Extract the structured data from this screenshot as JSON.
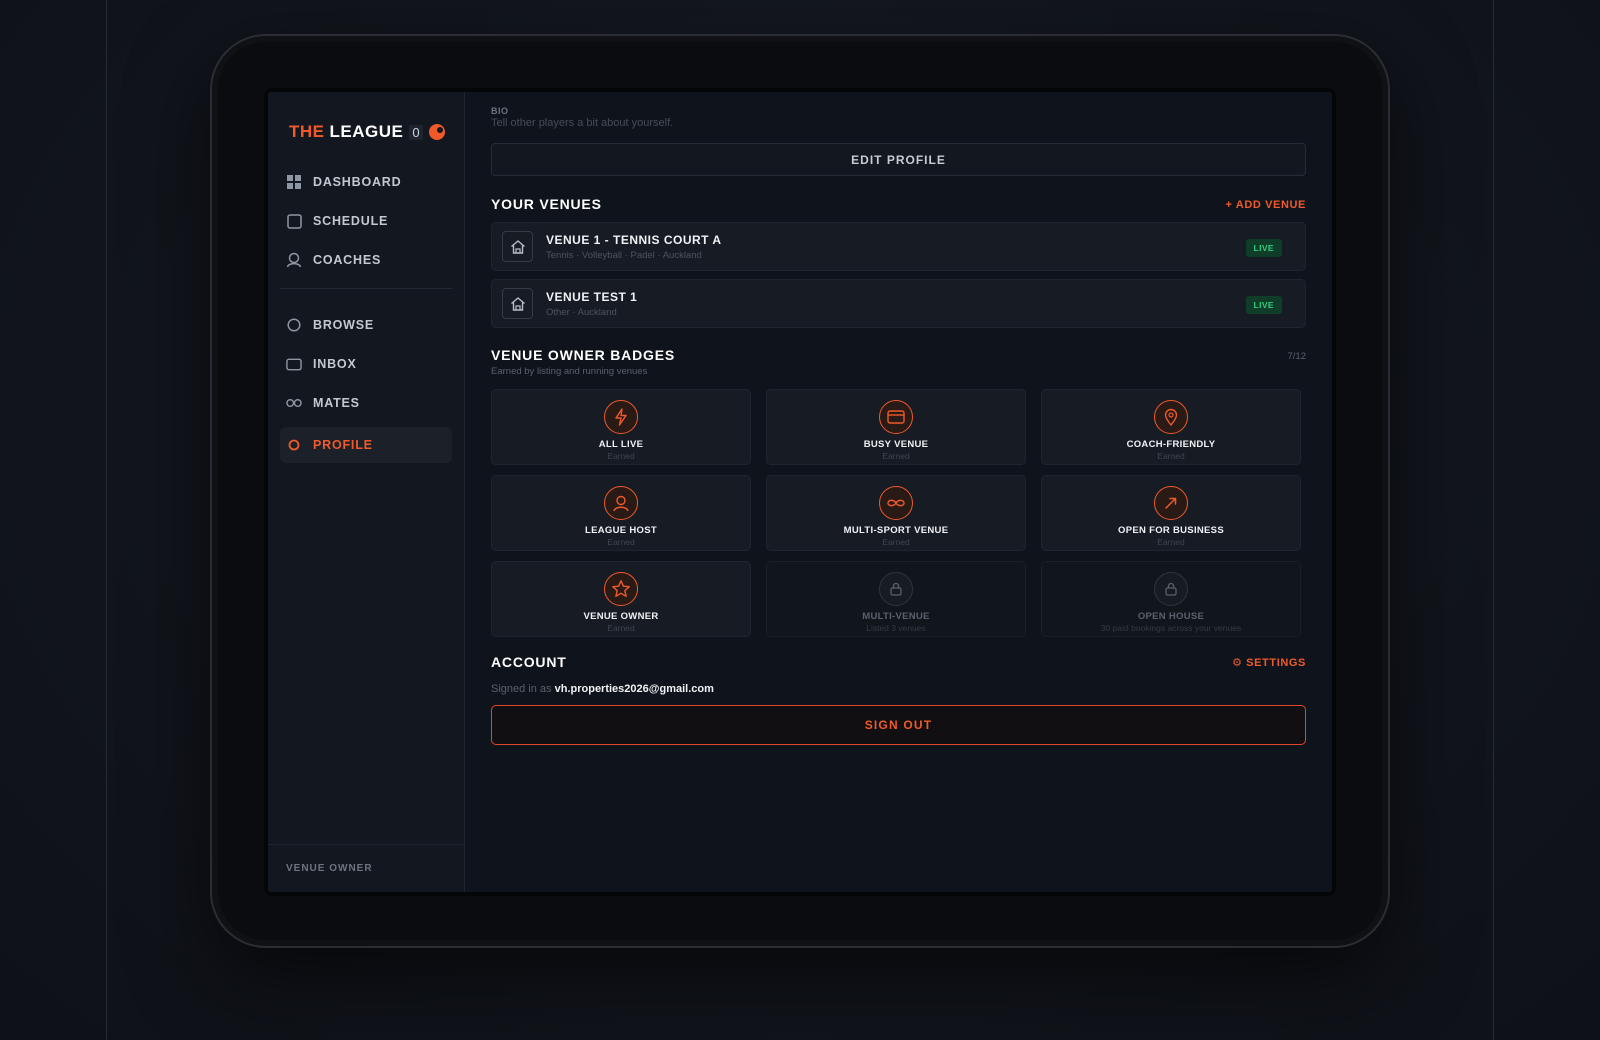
{
  "app": {
    "brand_the": "THE",
    "brand_league": "LEAGUE",
    "brand_count": "0",
    "accent_color": "#f05a2a"
  },
  "sidebar": {
    "items": [
      {
        "label": "DASHBOARD",
        "icon": "grid-icon"
      },
      {
        "label": "SCHEDULE",
        "icon": "calendar-icon"
      },
      {
        "label": "COACHES",
        "icon": "coach-icon"
      },
      {
        "label": "BROWSE",
        "icon": "circle-icon"
      },
      {
        "label": "INBOX",
        "icon": "inbox-icon"
      },
      {
        "label": "MATES",
        "icon": "infinity-icon"
      },
      {
        "label": "PROFILE",
        "icon": "profile-icon",
        "active": true
      }
    ],
    "footer_role": "VENUE OWNER"
  },
  "profile": {
    "bio_label": "BIO",
    "bio_placeholder": "Tell other players a bit about yourself.",
    "edit_button": "EDIT PROFILE"
  },
  "venues": {
    "title": "YOUR VENUES",
    "add_label": "+ ADD VENUE",
    "items": [
      {
        "name": "VENUE 1 - TENNIS COURT A",
        "meta": "Tennis · Volleyball · Padel · Auckland",
        "status": "LIVE"
      },
      {
        "name": "VENUE TEST 1",
        "meta": "Other · Auckland",
        "status": "LIVE"
      }
    ],
    "status_color": "#2ecf7b"
  },
  "badges": {
    "title": "VENUE OWNER BADGES",
    "subtitle": "Earned by listing and running venues",
    "count": "7/12",
    "items": [
      {
        "name": "ALL LIVE",
        "sub": "Earned",
        "icon": "bolt-icon",
        "earned": true
      },
      {
        "name": "BUSY VENUE",
        "sub": "Earned",
        "icon": "card-icon",
        "earned": true
      },
      {
        "name": "COACH-FRIENDLY",
        "sub": "Earned",
        "icon": "pin-icon",
        "earned": true
      },
      {
        "name": "LEAGUE HOST",
        "sub": "Earned",
        "icon": "person-icon",
        "earned": true
      },
      {
        "name": "MULTI-SPORT VENUE",
        "sub": "Earned",
        "icon": "infinity-icon",
        "earned": true
      },
      {
        "name": "OPEN FOR BUSINESS",
        "sub": "Earned",
        "icon": "arrow-icon",
        "earned": true
      },
      {
        "name": "VENUE OWNER",
        "sub": "Earned",
        "icon": "star-icon",
        "earned": true
      },
      {
        "name": "MULTI-VENUE",
        "sub": "Listed 3 venues",
        "icon": "lock-icon",
        "earned": false
      },
      {
        "name": "OPEN HOUSE",
        "sub": "30 paid bookings across your venues",
        "icon": "lock-icon",
        "earned": false
      }
    ]
  },
  "account": {
    "title": "ACCOUNT",
    "settings_label": "⚙ SETTINGS",
    "signed_prefix": "Signed in as",
    "email": "vh.properties2026@gmail.com",
    "sign_out": "SIGN OUT"
  }
}
